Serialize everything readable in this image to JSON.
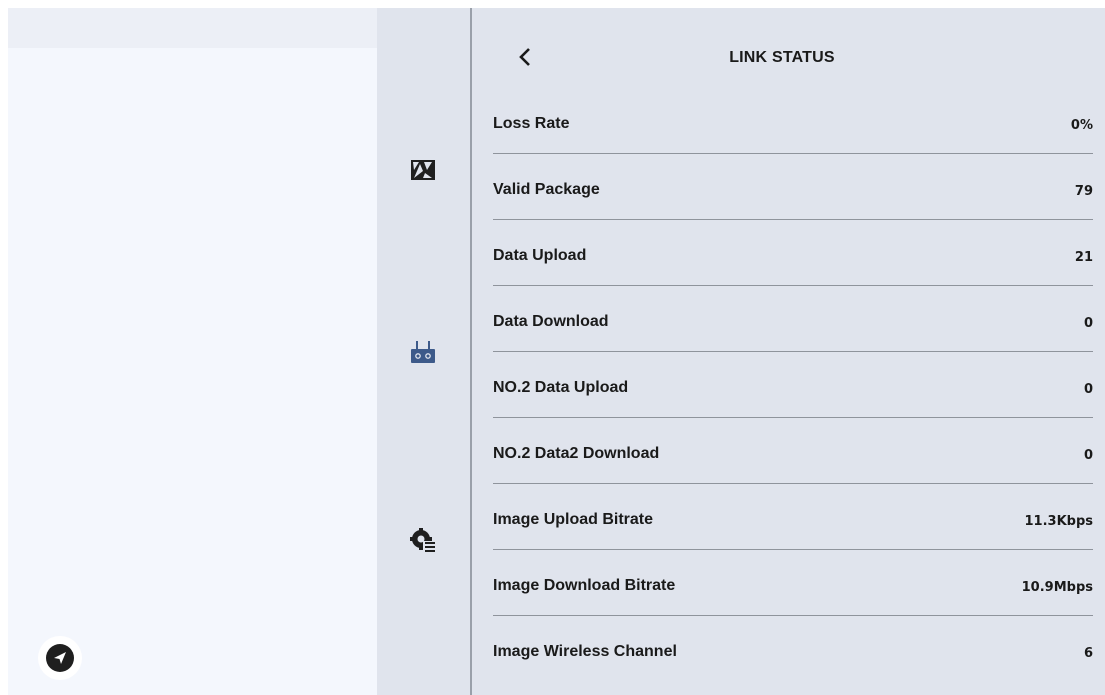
{
  "header": {
    "title": "LINK STATUS",
    "back_icon": "chevron-left-icon"
  },
  "rail": {
    "items": [
      {
        "icon": "camera-aperture-icon",
        "active": false
      },
      {
        "icon": "remote-controller-icon",
        "active": true
      },
      {
        "icon": "gear-list-icon",
        "active": false
      }
    ],
    "active_color": "#3d5a8a"
  },
  "fab": {
    "icon": "send-arrow-icon"
  },
  "rows": [
    {
      "label": "Loss Rate",
      "value": "0%"
    },
    {
      "label": "Valid Package",
      "value": "79"
    },
    {
      "label": "Data Upload",
      "value": "21"
    },
    {
      "label": "Data Download",
      "value": "0"
    },
    {
      "label": "NO.2 Data Upload",
      "value": "0"
    },
    {
      "label": "NO.2 Data2 Download",
      "value": "0"
    },
    {
      "label": "Image Upload Bitrate",
      "value": "11.3Kbps"
    },
    {
      "label": "Image Download Bitrate",
      "value": "10.9Mbps"
    },
    {
      "label": "Image Wireless Channel",
      "value": "6"
    }
  ]
}
